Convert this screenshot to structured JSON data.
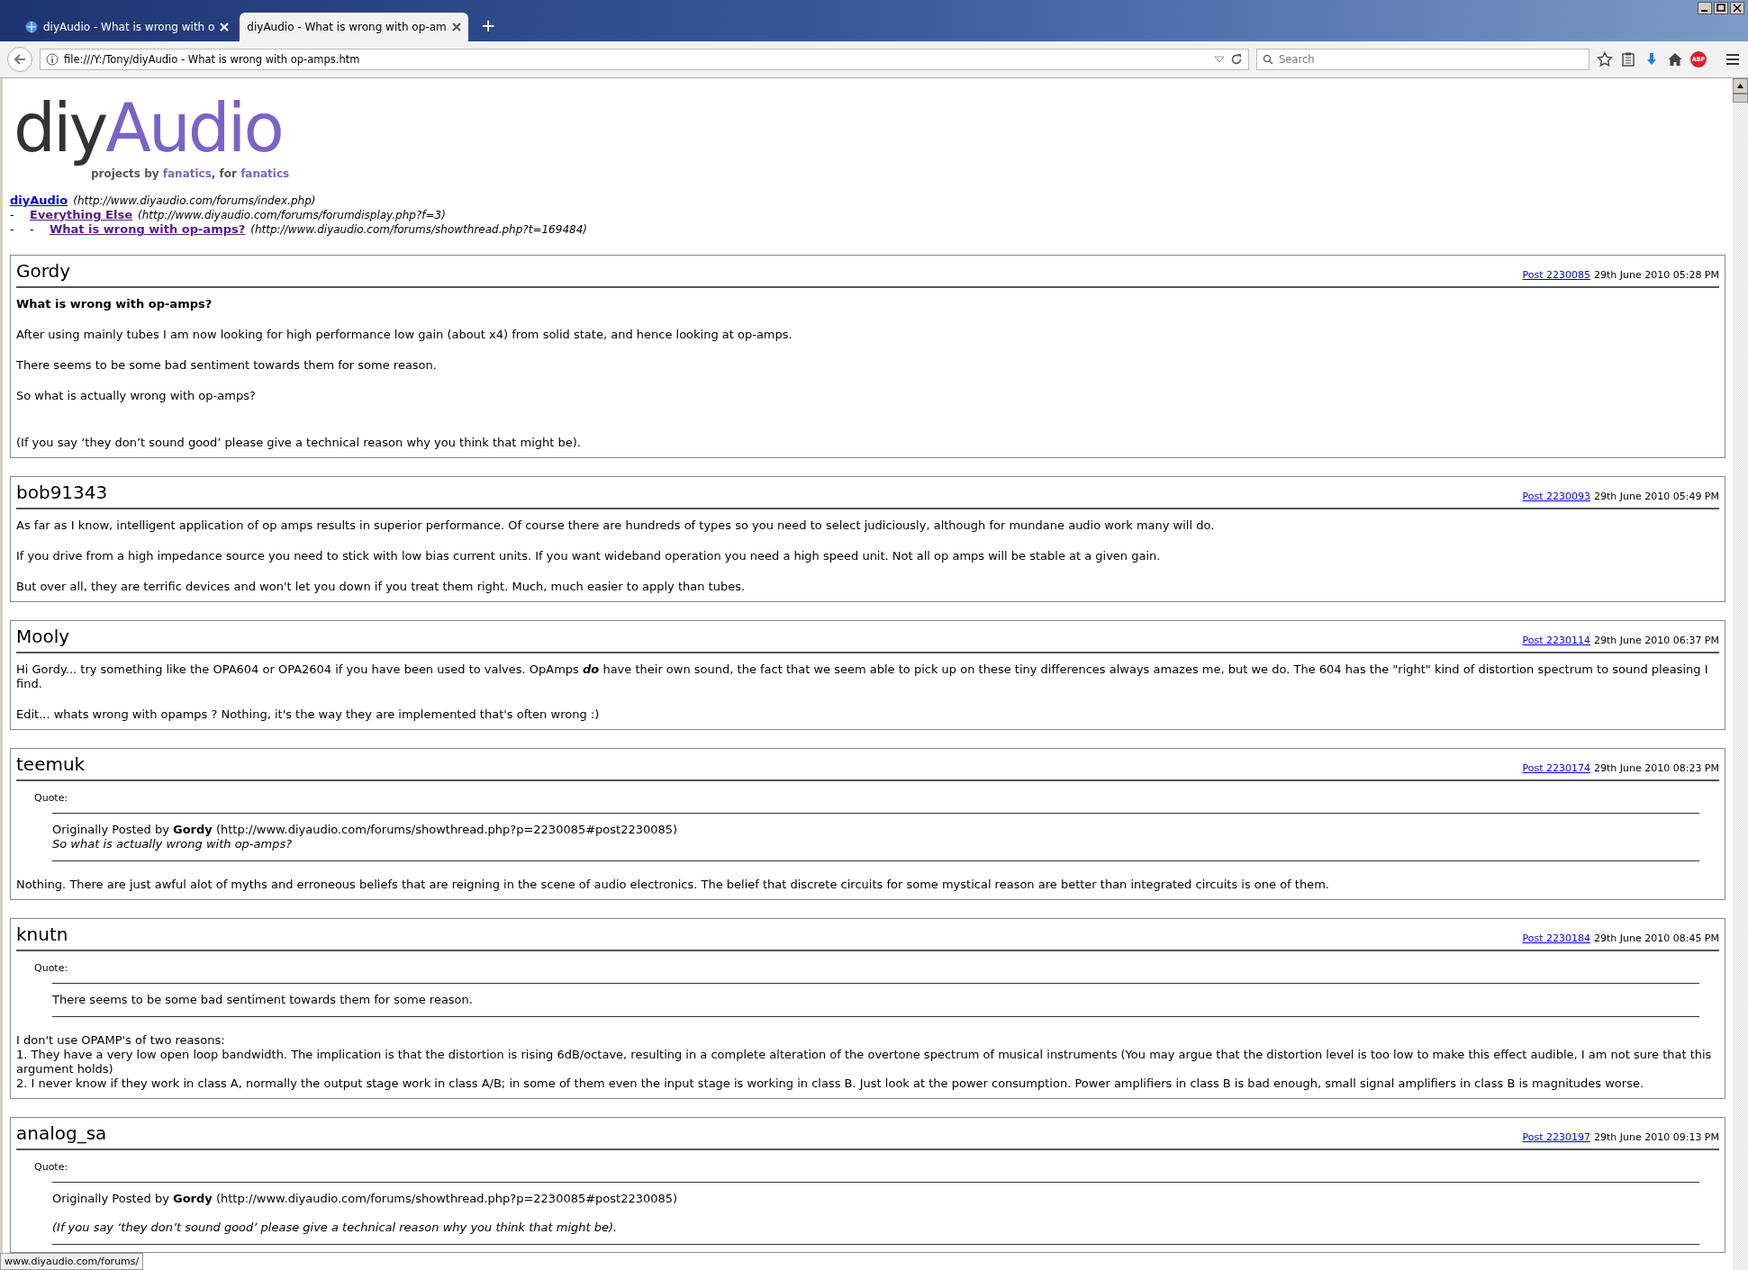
{
  "browser": {
    "tabs": [
      {
        "title": "diyAudio - What is wrong with o",
        "selected": false
      },
      {
        "title": "diyAudio - What is wrong with op-am",
        "selected": true
      }
    ],
    "new_tab": "+",
    "address": "file:///Y:/Tony/diyAudio - What is wrong with op-amps.htm",
    "search": {
      "placeholder": "Search"
    },
    "adblock_badge": "ABP"
  },
  "logo": {
    "dark": "diy",
    "accent": "Audio",
    "tagline": [
      {
        "text": "projects by ",
        "accent": false
      },
      {
        "text": "fanatics",
        "accent": true
      },
      {
        "text": ", for ",
        "accent": false
      },
      {
        "text": "fanatics",
        "accent": true
      }
    ]
  },
  "breadcrumbs": [
    {
      "label": "diyAudio",
      "url": "(http://www.diyaudio.com/forums/index.php)",
      "visited": false,
      "children": [
        {
          "label": "Everything Else",
          "url": "(http://www.diyaudio.com/forums/forumdisplay.php?f=3)",
          "visited": true,
          "dashes": [
            "-"
          ],
          "children": [
            {
              "label": "What is wrong with op-amps?",
              "url": "(http://www.diyaudio.com/forums/showthread.php?t=169484)",
              "visited": true,
              "dashes": [
                "-",
                "-"
              ]
            }
          ]
        }
      ]
    }
  ],
  "posts": [
    {
      "author": "Gordy",
      "post_link": "Post 2230085",
      "date": "29th June 2010 05:28 PM",
      "body": [
        {
          "kind": "title",
          "text": "What is wrong with op-amps?"
        },
        {
          "kind": "p",
          "text": "After using mainly tubes I am now looking for high performance low gain (about x4) from solid state, and hence looking at op-amps."
        },
        {
          "kind": "p",
          "text": "There seems to be some bad sentiment towards them for some reason."
        },
        {
          "kind": "p",
          "text": "So what is actually wrong with op-amps?"
        },
        {
          "kind": "blank"
        },
        {
          "kind": "p",
          "text": "(If you say ‘they don’t sound good’ please give a technical reason why you think that might be)."
        }
      ]
    },
    {
      "author": "bob91343",
      "post_link": "Post 2230093",
      "date": "29th June 2010 05:49 PM",
      "body": [
        {
          "kind": "p",
          "text": "As far as I know, intelligent application of op amps results in superior performance. Of course there are hundreds of types so you need to select judiciously, although for mundane audio work many will do."
        },
        {
          "kind": "p",
          "text": "If you drive from a high impedance source you need to stick with low bias current units. If you want wideband operation you need a high speed unit. Not all op amps will be stable at a given gain."
        },
        {
          "kind": "p",
          "text": "But over all, they are terrific devices and won't let you down if you treat them right. Much, much easier to apply than tubes."
        }
      ]
    },
    {
      "author": "Mooly",
      "post_link": "Post 2230114",
      "date": "29th June 2010 06:37 PM",
      "body": [
        {
          "kind": "p",
          "text": "Hi Gordy... try something like the OPA604 or OPA2604 if you have been used to valves. OpAmps **do** have their own sound, the fact that we seem able to pick up on these tiny differences always amazes me, but we do. The 604 has the \"right\" kind of distortion spectrum to sound pleasing I find."
        },
        {
          "kind": "p",
          "text": "Edit... whats wrong with opamps ? Nothing, it's the way they are implemented that's often wrong :)"
        }
      ]
    },
    {
      "author": "teemuk",
      "post_link": "Post 2230174",
      "date": "29th June 2010 08:23 PM",
      "body": [
        {
          "kind": "quote",
          "label": "Quote:",
          "attribution": "Originally Posted by **Gordy** (http://www.diyaudio.com/forums/showthread.php?p=2230085#post2230085)",
          "text": "So what is actually wrong with op-amps?",
          "italic": true,
          "blank_line": false
        },
        {
          "kind": "blank"
        },
        {
          "kind": "p",
          "text": "Nothing. There are just awful alot of myths and erroneous beliefs that are reigning in the scene of audio electronics. The belief that discrete circuits for some mystical reason are better than integrated circuits is one of them."
        }
      ]
    },
    {
      "author": "knutn",
      "post_link": "Post 2230184",
      "date": "29th June 2010 08:45 PM",
      "body": [
        {
          "kind": "quote",
          "label": "Quote:",
          "text": "There seems to be some bad sentiment towards them for some reason.",
          "italic": false,
          "blank_line": false
        },
        {
          "kind": "blank"
        },
        {
          "kind": "lines",
          "lines": [
            "I don't use OPAMP's of two reasons:",
            "1. They have a very low open loop bandwidth. The implication is that the distortion is rising 6dB/octave, resulting in a complete alteration of the overtone spectrum of musical instruments (You may argue that the distortion level is too low to make this effect audible, I am not sure that this argument holds)",
            "2. I never know if they work in class A, normally the output stage work in class A/B; in some of them even the input stage is working in class B. Just look at the power consumption. Power amplifiers in class B is bad enough, small signal amplifiers in class B is magnitudes worse."
          ]
        }
      ]
    },
    {
      "author": "analog_sa",
      "post_link": "Post 2230197",
      "date": "29th June 2010 09:13 PM",
      "body": [
        {
          "kind": "quote",
          "label": "Quote:",
          "attribution": "Originally Posted by **Gordy** (http://www.diyaudio.com/forums/showthread.php?p=2230085#post2230085)",
          "text": "(If you say ‘they don’t sound good’ please give a technical reason why you think that might be).",
          "italic": true,
          "blank_line": true
        }
      ]
    }
  ],
  "status_bar": "www.diyaudio.com/forums/"
}
